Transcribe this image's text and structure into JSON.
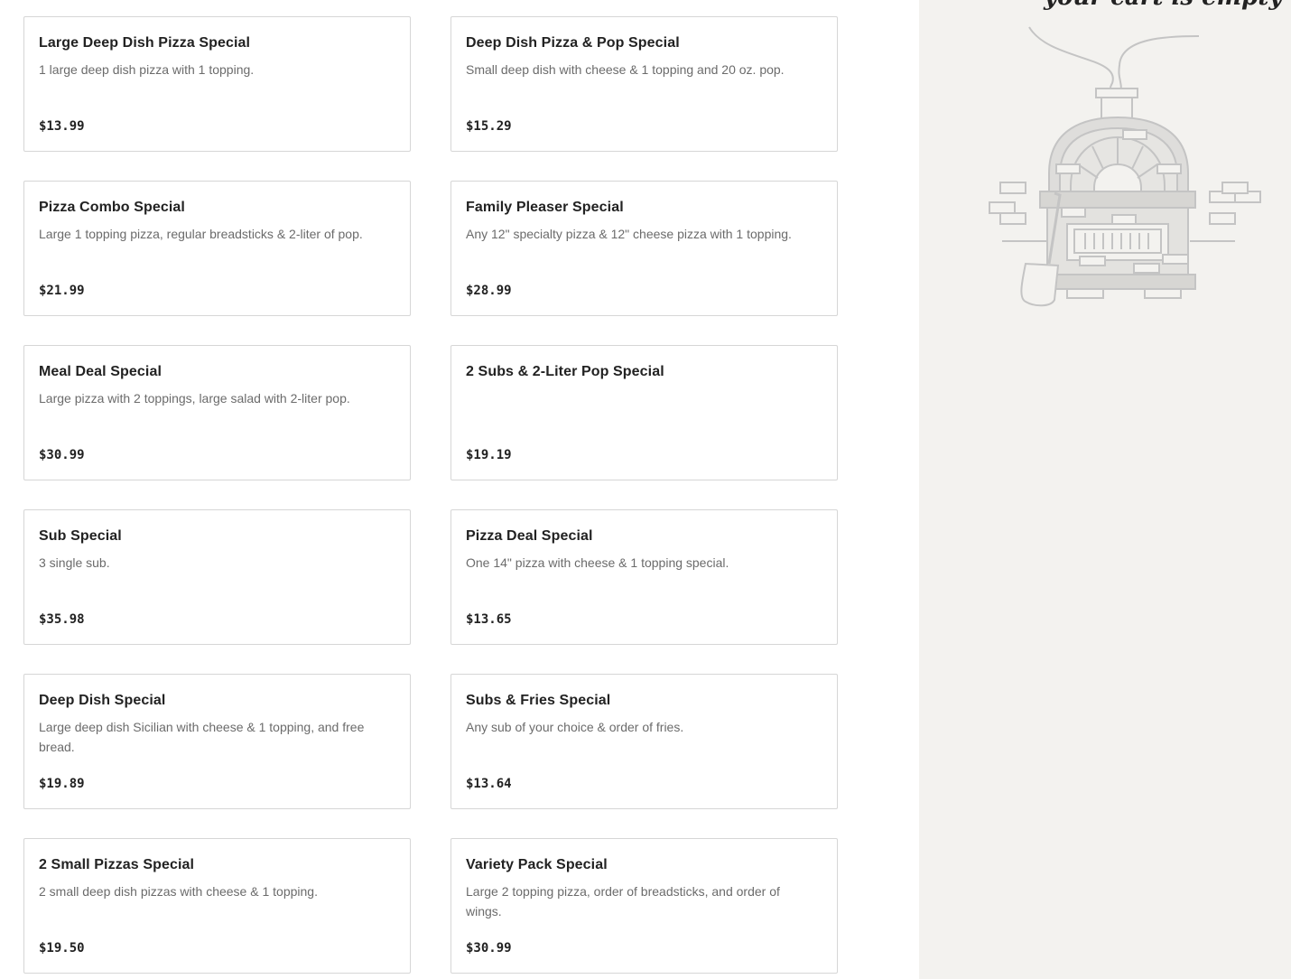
{
  "menu": {
    "items": [
      {
        "name": "Large Deep Dish Pizza Special",
        "description": "1 large deep dish pizza with 1 topping.",
        "price": "$13.99"
      },
      {
        "name": "Deep Dish Pizza & Pop Special",
        "description": "Small deep dish with cheese & 1 topping and 20 oz. pop.",
        "price": "$15.29"
      },
      {
        "name": "Pizza Combo Special",
        "description": "Large 1 topping pizza, regular breadsticks & 2-liter of pop.",
        "price": "$21.99"
      },
      {
        "name": "Family Pleaser Special",
        "description": "Any 12\" specialty pizza & 12\" cheese pizza with 1 topping.",
        "price": "$28.99"
      },
      {
        "name": "Meal Deal Special",
        "description": "Large pizza with 2 toppings, large salad with 2-liter pop.",
        "price": "$30.99"
      },
      {
        "name": "2 Subs & 2-Liter Pop Special",
        "description": "",
        "price": "$19.19"
      },
      {
        "name": "Sub Special",
        "description": "3 single sub.",
        "price": "$35.98"
      },
      {
        "name": "Pizza Deal Special",
        "description": "One 14\" pizza with cheese & 1 topping special.",
        "price": "$13.65"
      },
      {
        "name": "Deep Dish Special",
        "description": "Large deep dish Sicilian with cheese & 1 topping, and free bread.",
        "price": "$19.89"
      },
      {
        "name": "Subs & Fries Special",
        "description": "Any sub of your choice & order of fries.",
        "price": "$13.64"
      },
      {
        "name": "2 Small Pizzas Special",
        "description": "2 small deep dish pizzas with cheese & 1 topping.",
        "price": "$19.50"
      },
      {
        "name": "Variety Pack Special",
        "description": "Large 2 topping pizza, order of breadsticks, and order of wings.",
        "price": "$30.99"
      }
    ]
  },
  "cart": {
    "empty_text": "your cart is empty",
    "illustration_icon": "pizza-oven-icon",
    "background_color": "#f3f2ef",
    "illustration_color": "#c9c9c9"
  }
}
